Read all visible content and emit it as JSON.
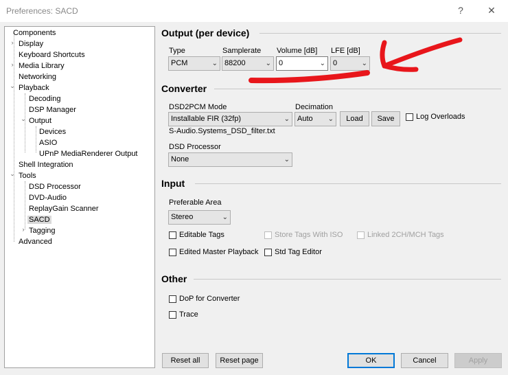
{
  "window": {
    "title": "Preferences: SACD",
    "help_label": "?",
    "close_label": "✕"
  },
  "tree": [
    {
      "label": "Components",
      "expander": ""
    },
    {
      "label": "Display",
      "expander": "›"
    },
    {
      "label": "Keyboard Shortcuts",
      "expander": ""
    },
    {
      "label": "Media Library",
      "expander": "›"
    },
    {
      "label": "Networking",
      "expander": ""
    },
    {
      "label": "Playback",
      "expander": "⌄"
    },
    {
      "label": "Decoding",
      "expander": ""
    },
    {
      "label": "DSP Manager",
      "expander": ""
    },
    {
      "label": "Output",
      "expander": "⌄"
    },
    {
      "label": "Devices",
      "expander": ""
    },
    {
      "label": "ASIO",
      "expander": ""
    },
    {
      "label": "UPnP MediaRenderer Output",
      "expander": ""
    },
    {
      "label": "Shell Integration",
      "expander": ""
    },
    {
      "label": "Tools",
      "expander": "⌄"
    },
    {
      "label": "DSD Processor",
      "expander": ""
    },
    {
      "label": "DVD-Audio",
      "expander": ""
    },
    {
      "label": "ReplayGain Scanner",
      "expander": ""
    },
    {
      "label": "SACD",
      "expander": ""
    },
    {
      "label": "Tagging",
      "expander": "›"
    },
    {
      "label": "Advanced",
      "expander": ""
    }
  ],
  "output": {
    "heading": "Output (per device)",
    "type_label": "Type",
    "type_value": "PCM",
    "samplerate_label": "Samplerate",
    "samplerate_value": "88200",
    "volume_label": "Volume [dB]",
    "volume_value": "0",
    "lfe_label": "LFE [dB]",
    "lfe_value": "0"
  },
  "converter": {
    "heading": "Converter",
    "mode_label": "DSD2PCM Mode",
    "mode_value": "Installable FIR (32fp)",
    "decimation_label": "Decimation",
    "decimation_value": "Auto",
    "load_label": "Load",
    "save_label": "Save",
    "log_overloads_label": "Log Overloads",
    "filter_file": "S-Audio.Systems_DSD_filter.txt",
    "dsd_processor_label": "DSD Processor",
    "dsd_processor_value": "None"
  },
  "input": {
    "heading": "Input",
    "area_label": "Preferable Area",
    "area_value": "Stereo",
    "editable_tags": "Editable Tags",
    "store_tags_iso": "Store Tags With ISO",
    "linked_tags": "Linked 2CH/MCH Tags",
    "edited_master": "Edited Master Playback",
    "std_tag_editor": "Std Tag Editor"
  },
  "other": {
    "heading": "Other",
    "dop": "DoP for Converter",
    "trace": "Trace"
  },
  "footer": {
    "reset_all": "Reset all",
    "reset_page": "Reset page",
    "ok": "OK",
    "cancel": "Cancel",
    "apply": "Apply"
  },
  "icons": {
    "dropdown": "chevron-down-icon"
  },
  "colors": {
    "annotation": "#e8161b",
    "accent": "#0078d7"
  }
}
